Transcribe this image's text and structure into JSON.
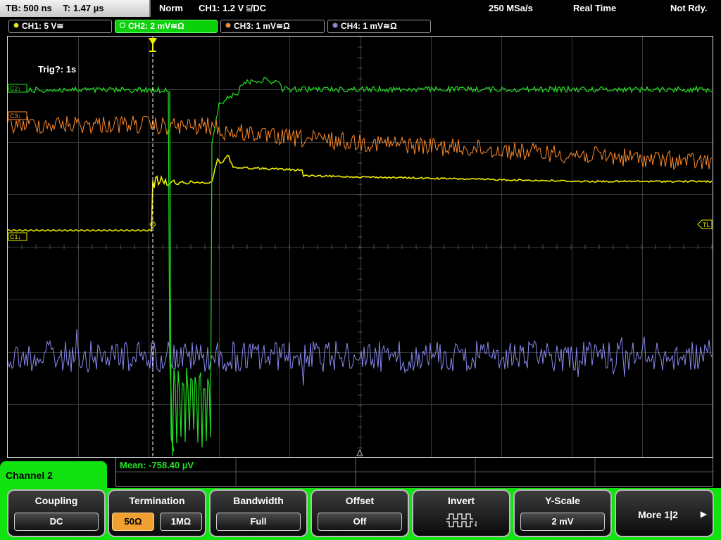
{
  "topbar": {
    "timebase": "TB: 500 ns",
    "time": "T: 1.47 µs",
    "mode": "Norm",
    "trigger": "CH1: 1.2 V ⫅/DC",
    "sample_rate": "250 MSa/s",
    "acq_mode": "Real Time",
    "status": "Not Rdy."
  },
  "channels": [
    {
      "label": "CH1: 5 V≅",
      "color": "#f0f000",
      "active": false
    },
    {
      "label": "CH2: 2 mV≅Ω",
      "color": "#22e022",
      "active": true
    },
    {
      "label": "CH3: 1 mV≅Ω",
      "color": "#ff8a2a",
      "active": false
    },
    {
      "label": "CH4: 1 mV≅Ω",
      "color": "#8888ee",
      "active": false
    }
  ],
  "scope": {
    "trigger_info": "Trig?: 1s",
    "markers": {
      "c1": "C1↓",
      "c2": "C2↓",
      "c3": "C3↓",
      "tl": "TL"
    },
    "colors": {
      "ch1": "#f0f000",
      "ch2": "#22e022",
      "ch3": "#ff8a2a",
      "ch4": "#8888ee"
    }
  },
  "measurement": {
    "text": "Mean: -758.40 µV"
  },
  "menu": {
    "title": "Channel 2",
    "softkeys": {
      "coupling": {
        "title": "Coupling",
        "value": "DC"
      },
      "termination": {
        "title": "Termination",
        "option_a": "50Ω",
        "option_b": "1MΩ"
      },
      "bandwidth": {
        "title": "Bandwidth",
        "value": "Full"
      },
      "offset": {
        "title": "Offset",
        "value": "Off"
      },
      "invert": {
        "title": "Invert"
      },
      "yscale": {
        "title": "Y-Scale",
        "value": "2 mV"
      },
      "more": {
        "label": "More 1|2"
      }
    }
  }
}
